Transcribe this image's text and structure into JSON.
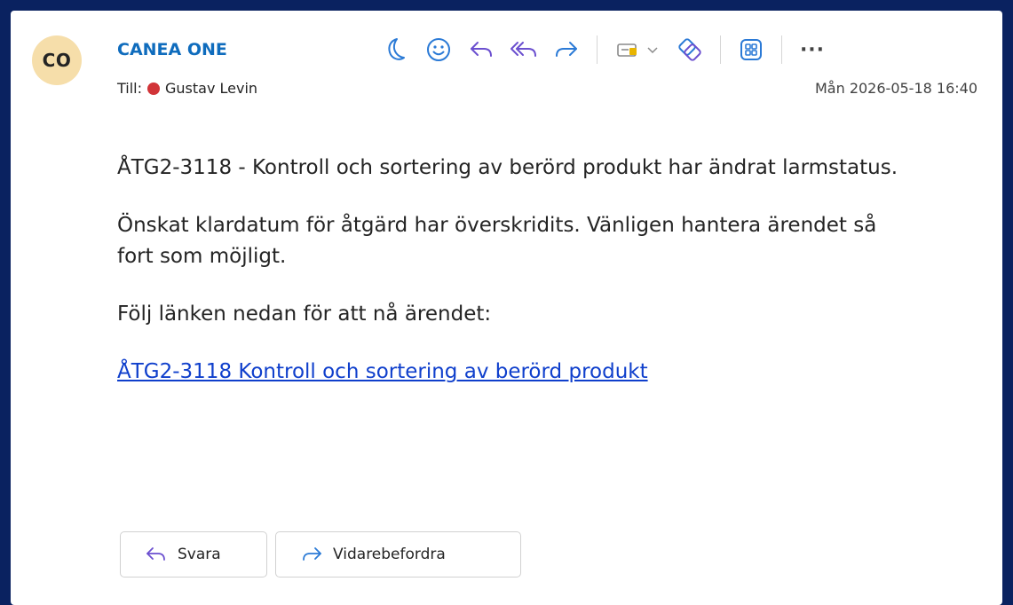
{
  "sender": {
    "initials": "CO",
    "name": "CANEA ONE"
  },
  "recipient": {
    "label": "Till:",
    "name": "Gustav Levin",
    "presence_color": "#d13438"
  },
  "date": "Mån 2026-05-18 16:40",
  "toolbar": {
    "icons": [
      "snooze-icon",
      "emoji-icon",
      "reply-icon",
      "reply-all-icon",
      "forward-icon",
      "tag-icon",
      "chevron-down-icon",
      "loop-icon",
      "apps-icon"
    ],
    "more_label": "···"
  },
  "message": {
    "paragraph1": "ÅTG2-3118 - Kontroll och sortering av berörd produkt har ändrat larmstatus.",
    "paragraph2": "Önskat klardatum för åtgärd har överskridits. Vänligen hantera ärendet så fort som möjligt.",
    "paragraph3": "Följ länken nedan för att nå ärendet:",
    "link_text": "ÅTG2-3118 Kontroll och sortering av berörd produkt"
  },
  "actions": {
    "reply_label": "Svara",
    "forward_label": "Vidarebefordra"
  },
  "colors": {
    "accent": "#0f6cbd",
    "background": "#0a2260",
    "icon_purple": "#6b4fcf",
    "icon_blue": "#2b7ad6"
  }
}
